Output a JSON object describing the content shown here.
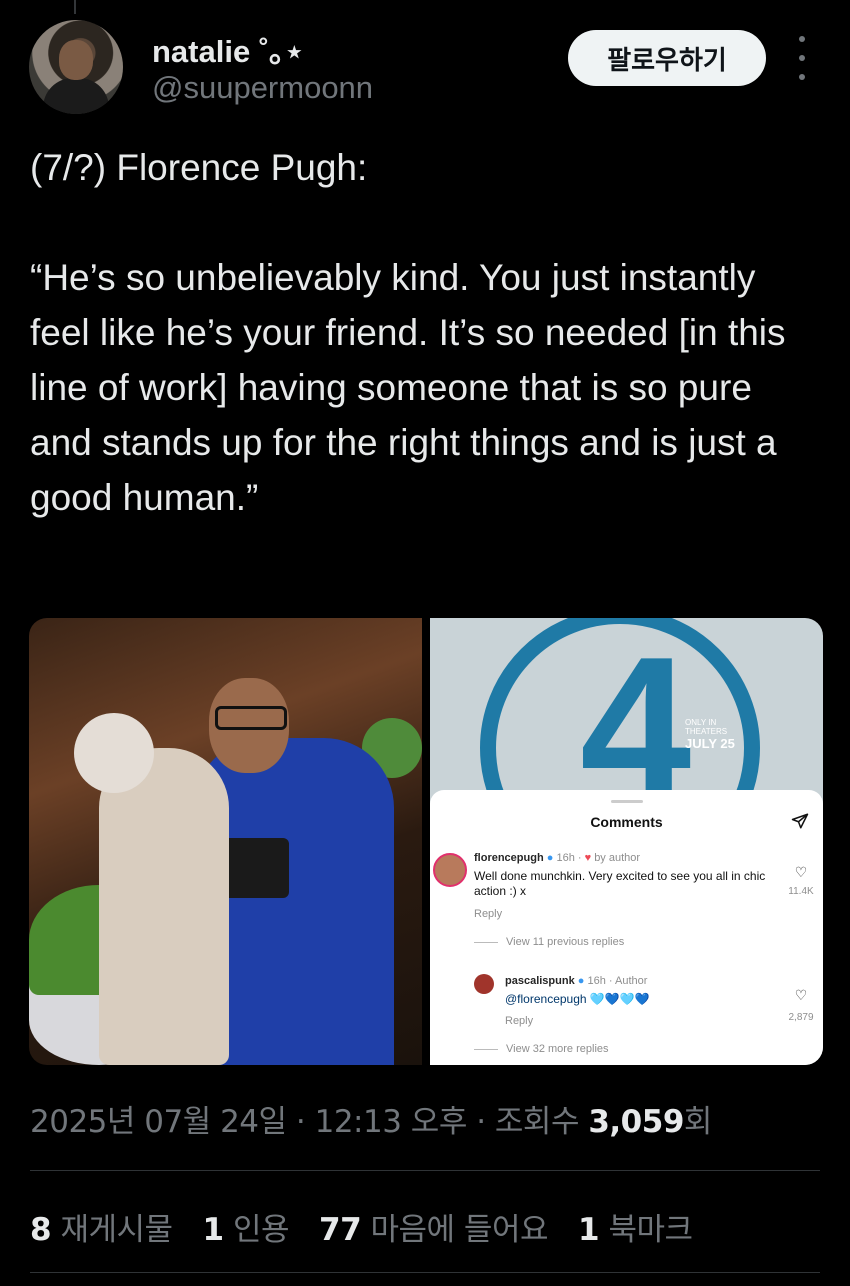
{
  "user": {
    "display_name": "natalie ˚｡⋆",
    "handle": "@suupermoonn",
    "follow_label": "팔로우하기"
  },
  "tweet": {
    "text": "(7/?) Florence Pugh:\n\n“He’s so unbelievably kind. You just instantly feel like he’s your friend. It’s so needed [in this line of work] having someone that is so pure and stands up for the right things and is just a good human.”"
  },
  "poster": {
    "number": "4",
    "date": "JULY 25",
    "small_text": "ONLY IN THEATERS"
  },
  "instagram": {
    "title": "Comments",
    "comment1": {
      "username": "florencepugh",
      "meta": "16h ·",
      "byline": "by author",
      "text": "Well done munchkin. Very excited to see you all in chic action :) x",
      "reply": "Reply",
      "likes": "11.4K"
    },
    "view_previous": "View 11 previous replies",
    "comment2": {
      "username": "pascalispunk",
      "meta": "16h · Author",
      "mention": "@florencepugh",
      "hearts": "🩵💙🩵💙",
      "reply": "Reply",
      "likes": "2,879"
    },
    "view_more": "View 32 more replies"
  },
  "meta": {
    "timestamp": "2025년 07월 24일 · 12:13 오후 · 조회수 ",
    "views": "3,059",
    "views_suffix": "회"
  },
  "stats": {
    "reposts_count": "8",
    "reposts_label": "재게시물",
    "quotes_count": "1",
    "quotes_label": "인용",
    "likes_count": "77",
    "likes_label": "마음에 들어요",
    "bookmarks_count": "1",
    "bookmarks_label": "북마크"
  },
  "colors": {
    "background": "#000000",
    "text": "#e7e9ea",
    "secondary": "#71767b",
    "follow_bg": "#eff3f4"
  }
}
